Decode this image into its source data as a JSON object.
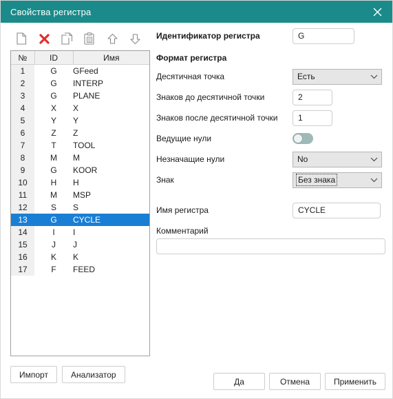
{
  "window": {
    "title": "Свойства регистра",
    "titlebar_color": "#1b8a8a",
    "close_icon": "close-icon"
  },
  "toolbar": {
    "items": [
      {
        "name": "new-document-icon",
        "label": "Новый"
      },
      {
        "name": "delete-icon",
        "label": "Удалить"
      },
      {
        "name": "copy-icon",
        "label": "Копировать"
      },
      {
        "name": "paste-icon",
        "label": "Вставить"
      },
      {
        "name": "move-up-icon",
        "label": "Вверх"
      },
      {
        "name": "move-down-icon",
        "label": "Вниз"
      }
    ],
    "delete_color": "#e03030"
  },
  "list": {
    "columns": [
      "№",
      "ID",
      "Имя"
    ],
    "selected_index": 12,
    "selection_color": "#1a7fd4",
    "rows": [
      {
        "num": "1",
        "id": "G",
        "name": "GFeed"
      },
      {
        "num": "2",
        "id": "G",
        "name": "INTERP"
      },
      {
        "num": "3",
        "id": "G",
        "name": "PLANE"
      },
      {
        "num": "4",
        "id": "X",
        "name": "X"
      },
      {
        "num": "5",
        "id": "Y",
        "name": "Y"
      },
      {
        "num": "6",
        "id": "Z",
        "name": "Z"
      },
      {
        "num": "7",
        "id": "T",
        "name": "TOOL"
      },
      {
        "num": "8",
        "id": "M",
        "name": "M"
      },
      {
        "num": "9",
        "id": "G",
        "name": "KOOR"
      },
      {
        "num": "10",
        "id": "H",
        "name": "H"
      },
      {
        "num": "11",
        "id": "M",
        "name": "MSP"
      },
      {
        "num": "12",
        "id": "S",
        "name": "S"
      },
      {
        "num": "13",
        "id": "G",
        "name": "CYCLE"
      },
      {
        "num": "14",
        "id": "I",
        "name": "I"
      },
      {
        "num": "15",
        "id": "J",
        "name": "J"
      },
      {
        "num": "16",
        "id": "K",
        "name": "K"
      },
      {
        "num": "17",
        "id": "F",
        "name": "FEED"
      }
    ]
  },
  "form": {
    "identifier_label": "Идентификатор регистра",
    "identifier_value": "G",
    "section_title": "Формат регистра",
    "decimal_point_label": "Десятичная точка",
    "decimal_point_value": "Есть",
    "digits_before_label": "Знаков до десятичной точки",
    "digits_before_value": "2",
    "digits_after_label": "Знаков после десятичной точки",
    "digits_after_value": "1",
    "leading_zeros_label": "Ведущие нули",
    "leading_zeros_state": "off",
    "trailing_zeros_label": "Незначащие нули",
    "trailing_zeros_value": "No",
    "sign_label": "Знак",
    "sign_value": "Без знака",
    "register_name_label": "Имя регистра",
    "register_name_value": "CYCLE",
    "comment_label": "Комментарий",
    "comment_value": "",
    "comment_placeholder": ""
  },
  "buttons": {
    "import": "Импорт",
    "analyzer": "Анализатор",
    "ok": "Да",
    "cancel": "Отмена",
    "apply": "Применить"
  }
}
